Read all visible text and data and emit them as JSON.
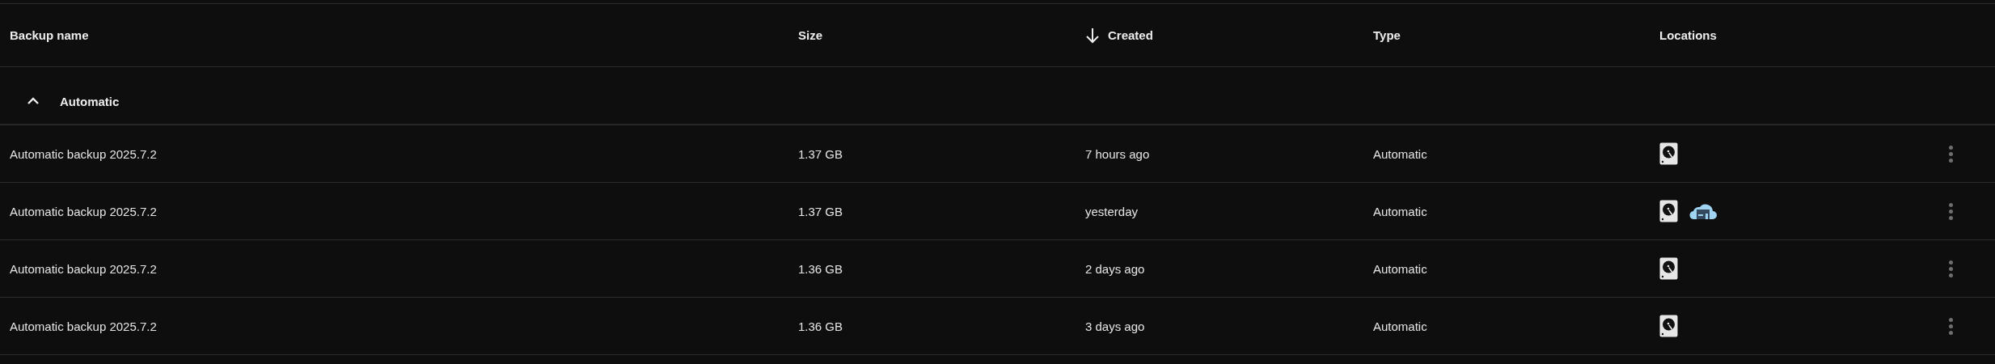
{
  "table": {
    "columns": [
      {
        "label": "Backup name",
        "sorted": false
      },
      {
        "label": "Size",
        "sorted": false
      },
      {
        "label": "Created",
        "sorted": true
      },
      {
        "label": "Type",
        "sorted": false
      },
      {
        "label": "Locations",
        "sorted": false
      }
    ],
    "groups": [
      {
        "label": "Automatic",
        "expanded": true,
        "rows": [
          {
            "name": "Automatic backup 2025.7.2",
            "size": "1.37 GB",
            "created": "7 hours ago",
            "type": "Automatic",
            "locations": [
              {
                "kind": "local"
              }
            ]
          },
          {
            "name": "Automatic backup 2025.7.2",
            "size": "1.37 GB",
            "created": "yesterday",
            "type": "Automatic",
            "locations": [
              {
                "kind": "local"
              },
              {
                "kind": "cloud"
              }
            ]
          },
          {
            "name": "Automatic backup 2025.7.2",
            "size": "1.36 GB",
            "created": "2 days ago",
            "type": "Automatic",
            "locations": [
              {
                "kind": "local"
              }
            ]
          },
          {
            "name": "Automatic backup 2025.7.2",
            "size": "1.36 GB",
            "created": "3 days ago",
            "type": "Automatic",
            "locations": [
              {
                "kind": "local"
              }
            ]
          }
        ]
      }
    ]
  }
}
